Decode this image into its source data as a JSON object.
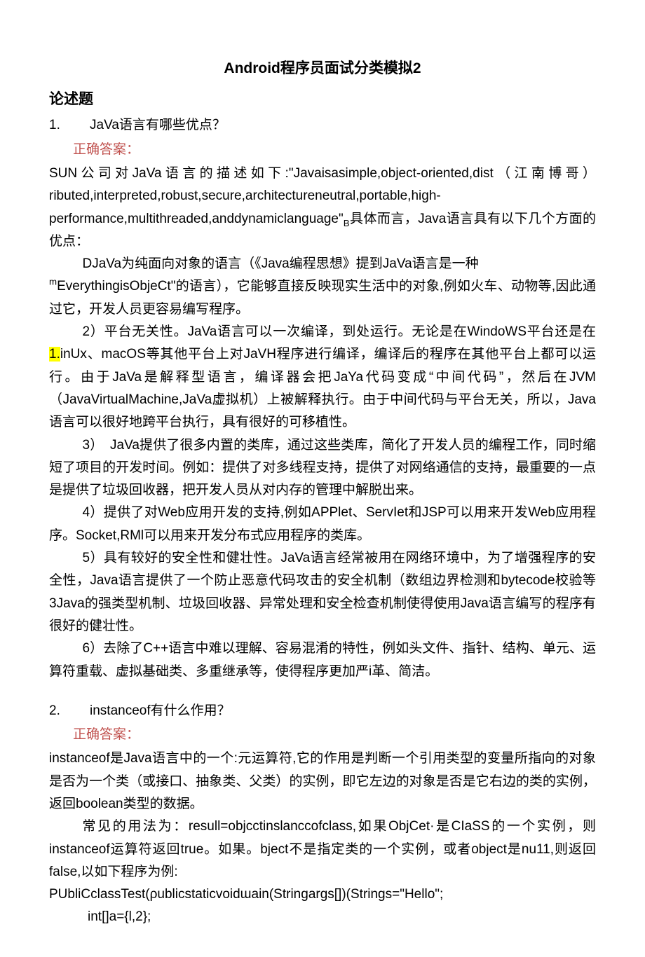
{
  "title": "Android程序员面试分类模拟2",
  "section": "论述题",
  "q1": {
    "num": "1.",
    "text": "JaVa语言有哪些优点？",
    "ans_label": "正确答案：",
    "p1a": "SUN公司对JaVa语言的描述如下:\"Javaisasimple,object-oriented,dist（江南博哥）ributed,interpreted,robust,secure,architectureneutral,portable,high-performance,multithreaded,anddynamiclanguage\"",
    "p1b": "具体而言，Java语言具有以下几个方面的优点：",
    "p2a": "DJaVa为纯面向对象的语言（《Java编程思想》提到JaVa语言是一种",
    "p2b": "EverythingisObjeCt\"的语言），它能够直接反映现实生活中的对象,例如火车、动物等,因此通过它，开发人员更容易编写程序。",
    "p3a": "2）平台无关性。JaVa语言可以一次编译，到处运行。无论是在WindoWS平台还是在",
    "p3b": "inUx、macOS等其他平台上对JaVH程序进行编译，编译后的程序在其他平台上都可以运行。由于JaVa是解释型语言，编译器会把JaYa代码变成“中间代码”，然后在JVM（JavaVirtualMachine,JaVa虚拟机）上被解释执行。由于中间代码与平台无关，所以，Java语言可以很好地跨平台执行，具有很好的可移植性。",
    "p4": "3）　JaVa提供了很多内置的类库，通过这些类库，简化了开发人员的编程工作，同时缩短了项目的开发时间。例如：提供了对多线程支持，提供了对网络通信的支持，最重要的一点是提供了垃圾回收器，把开发人员从对内存的管理中解脱出来。",
    "p5": "4）提供了对Web应用开发的支持,例如APPlet、ServIet和JSP可以用来开发Web应用程序。Socket,RMl可以用来开发分布式应用程序的类库。",
    "p6": "5）具有较好的安全性和健壮性。JaVa语言经常被用在网络环境中，为了增强程序的安全性，Java语言提供了一个防止恶意代码攻击的安全机制（数组边界检测和bytecode校验等3Java的强类型机制、垃圾回收器、异常处理和安全检查机制使得使用Java语言编写的程序有很好的健壮性。",
    "p7": "6）去除了C++语言中难以理解、容易混淆的特性，例如头文件、指针、结构、单元、运算符重载、虚拟基础类、多重继承等，使得程序更加严i革、简洁。"
  },
  "q2": {
    "num": "2.",
    "text": "instanceof有什么作用？",
    "ans_label": "正确答案：",
    "p1": "instanceof是Java语言中的一个:元运算符,它的作用是判断一个引用类型的变量所指向的对象是否为一个类（或接口、抽象类、父类）的实例，即它左边的对象是否是它右边的类的实例，返回boolean类型的数据。",
    "p2": "常见的用法为：resull=objcctinslanccofclass,如果ObjCet·是CIaSS的一个实例，则instanceof运算符返回true。如果。bject不是指定类的一个实例，或者object是nu11,则返回false,以如下程序为例:",
    "p3": "PUbliCclassTest(ρublicstaticvoidɯain(Stringargs[])(Strings=\"Hello\";",
    "p4": "int[]a={l,2};"
  },
  "hl_text": "1."
}
